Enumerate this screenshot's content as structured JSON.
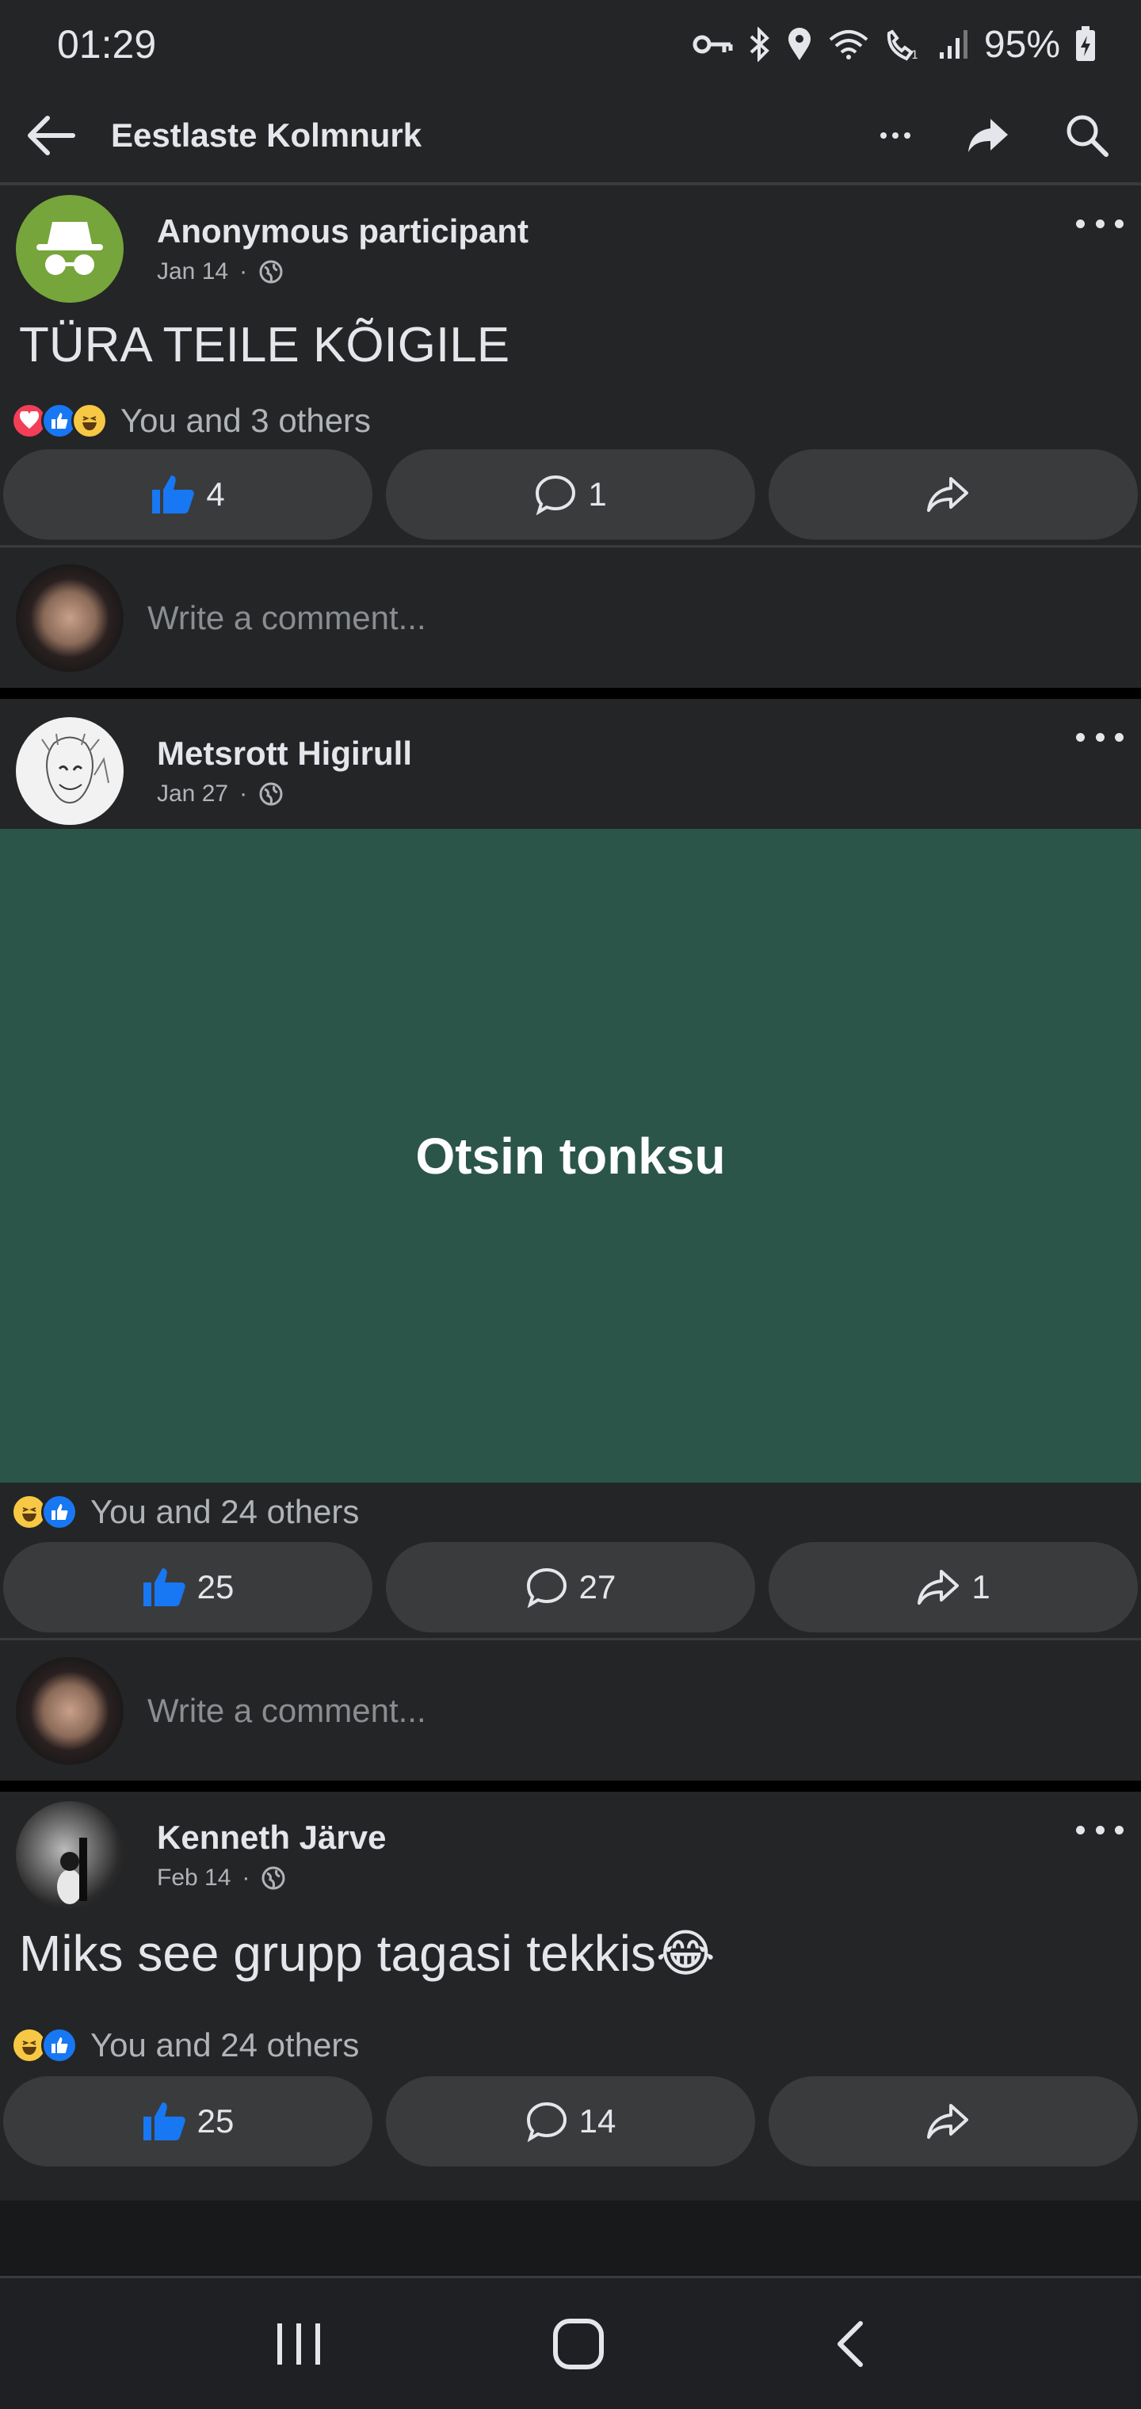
{
  "status_bar": {
    "time": "01:29",
    "battery": "95%"
  },
  "header": {
    "title": "Eestlaste Kolmnurk"
  },
  "posts": [
    {
      "author": "Anonymous participant",
      "date": "Jan 14",
      "text": "TÜRA TEILE KÕIGILE",
      "reactions_text": "You and 3 others",
      "like_count": "4",
      "comment_count": "1",
      "share_count": ""
    },
    {
      "author": "Metsrott Higirull",
      "date": "Jan 27",
      "text": "Otsin tonksu",
      "reactions_text": "You and 24 others",
      "like_count": "25",
      "comment_count": "27",
      "share_count": "1"
    },
    {
      "author": "Kenneth Järve",
      "date": "Feb 14",
      "text": "Miks see grupp tagasi tekkis😂",
      "reactions_text": "You and 24 others",
      "like_count": "25",
      "comment_count": "14",
      "share_count": ""
    }
  ],
  "comment_placeholder": "Write a comment...",
  "colors": {
    "like_blue": "#1877f2",
    "post_bg_green": "#2b5549"
  }
}
